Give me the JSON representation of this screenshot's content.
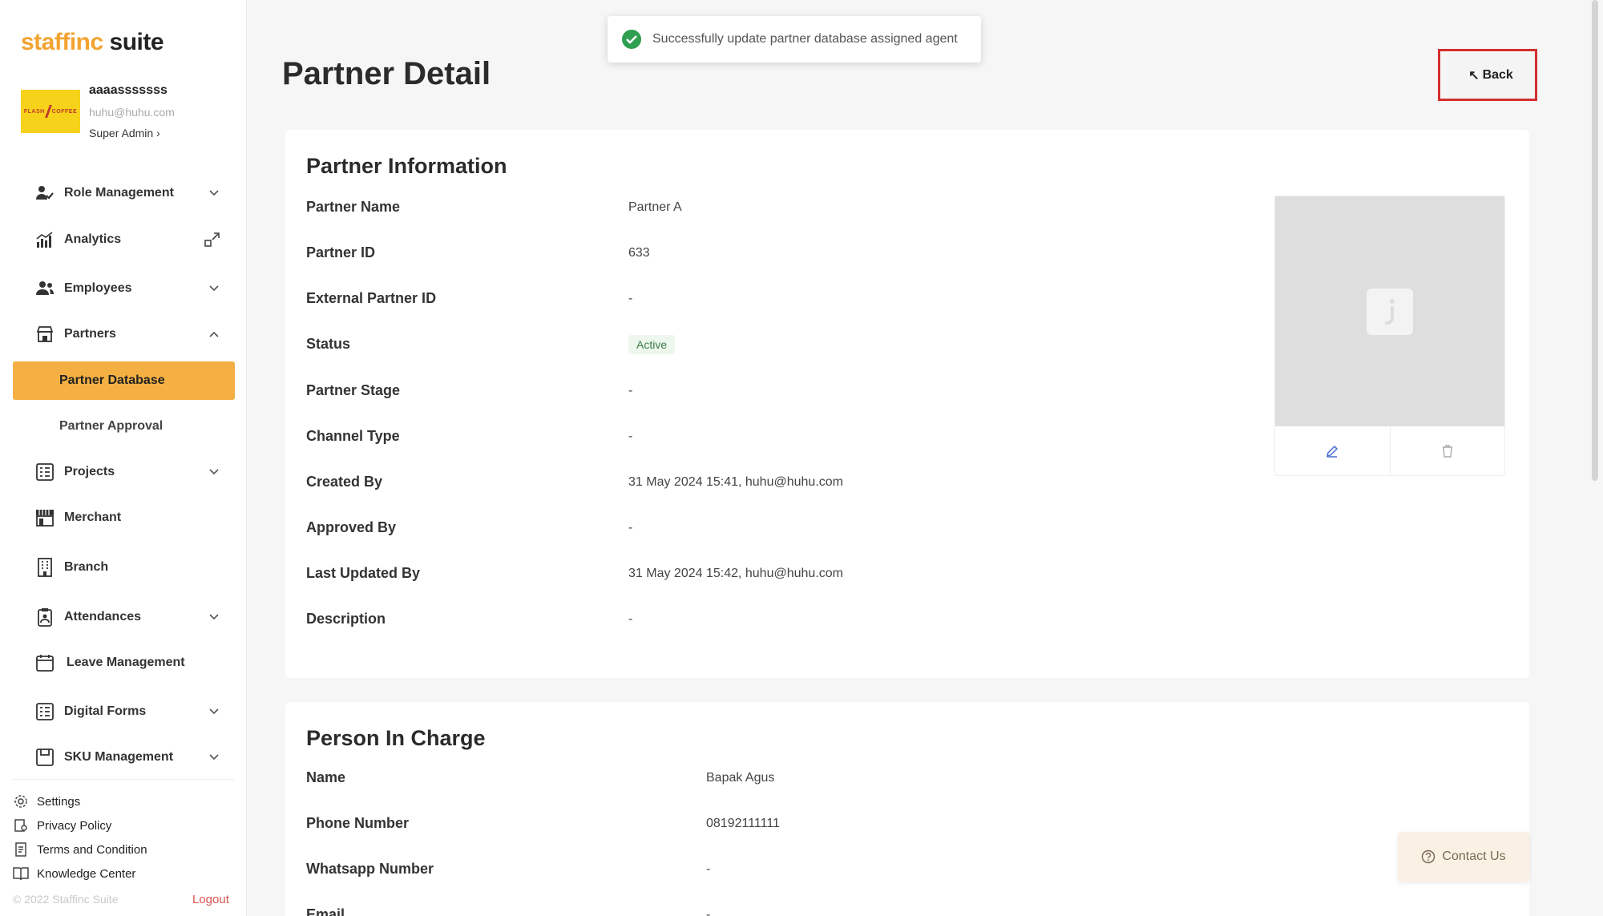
{
  "brand": {
    "logo_part1": "staffinc",
    "logo_part2": " suite"
  },
  "profile": {
    "avatar_text": "FLASH COFFEE",
    "name": "aaaasssssss",
    "email": "huhu@huhu.com",
    "role": "Super Admin ›"
  },
  "sidebar": {
    "items": [
      {
        "label": "Role Management",
        "icon": "role-icon",
        "chevron": "down"
      },
      {
        "label": "Analytics",
        "icon": "analytics-icon",
        "chevron": "external"
      },
      {
        "label": "Employees",
        "icon": "employees-icon",
        "chevron": "down"
      },
      {
        "label": "Partners",
        "icon": "partners-icon",
        "chevron": "up"
      },
      {
        "label": "Projects",
        "icon": "projects-icon",
        "chevron": "down"
      },
      {
        "label": "Merchant",
        "icon": "merchant-icon",
        "chevron": ""
      },
      {
        "label": "Branch",
        "icon": "branch-icon",
        "chevron": ""
      },
      {
        "label": "Attendances",
        "icon": "attendance-icon",
        "chevron": "down"
      },
      {
        "label": "Leave Management",
        "icon": "calendar-icon",
        "chevron": ""
      },
      {
        "label": "Digital Forms",
        "icon": "forms-icon",
        "chevron": "down"
      },
      {
        "label": "SKU Management",
        "icon": "sku-icon",
        "chevron": "down"
      }
    ],
    "sub_items": [
      {
        "label": "Partner Database",
        "active": true
      },
      {
        "label": "Partner Approval",
        "active": false
      }
    ],
    "footer": [
      {
        "label": "Settings",
        "icon": "gear-icon"
      },
      {
        "label": "Privacy Policy",
        "icon": "privacy-icon"
      },
      {
        "label": "Terms and Condition",
        "icon": "terms-icon"
      },
      {
        "label": "Knowledge Center",
        "icon": "book-icon"
      }
    ],
    "copyright": "© 2022 Staffinc Suite",
    "logout": "Logout"
  },
  "header": {
    "title": "Partner Detail",
    "back_label": "Back"
  },
  "toast": {
    "message": "Successfully update partner database assigned agent"
  },
  "partner_info": {
    "title": "Partner Information",
    "rows": [
      {
        "label": "Partner Name",
        "value": "Partner A"
      },
      {
        "label": "Partner ID",
        "value": "633"
      },
      {
        "label": "External Partner ID",
        "value": "-"
      },
      {
        "label": "Status",
        "value": "Active"
      },
      {
        "label": "Partner Stage",
        "value": "-"
      },
      {
        "label": "Channel Type",
        "value": "-"
      },
      {
        "label": "Created By",
        "value": "31 May 2024 15:41, huhu@huhu.com"
      },
      {
        "label": "Approved By",
        "value": "-"
      },
      {
        "label": "Last Updated By",
        "value": "31 May 2024 15:42, huhu@huhu.com"
      },
      {
        "label": "Description",
        "value": "-"
      }
    ]
  },
  "pic": {
    "title": "Person In Charge",
    "rows": [
      {
        "label": "Name",
        "value": "Bapak Agus"
      },
      {
        "label": "Phone Number",
        "value": "08192111111"
      },
      {
        "label": "Whatsapp Number",
        "value": "-"
      },
      {
        "label": "Email",
        "value": "-"
      }
    ]
  },
  "contact": {
    "label": "Contact Us"
  },
  "colors": {
    "accent": "#f4b042",
    "success": "#2e9e4f",
    "highlight": "#d32f2f"
  }
}
